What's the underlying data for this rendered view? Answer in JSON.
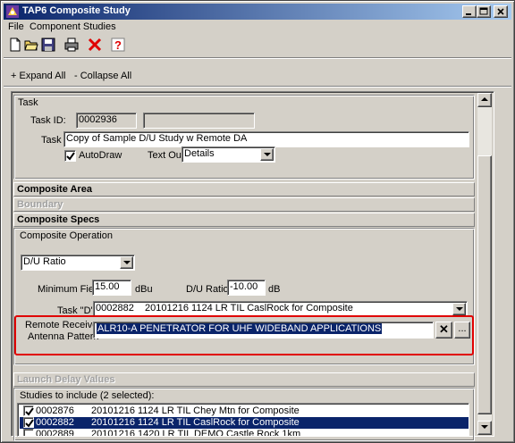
{
  "window": {
    "title": "TAP6 Composite Study"
  },
  "menu": {
    "file": "File",
    "component_studies": "Component Studies"
  },
  "toolbar": {
    "icons": [
      "new-icon",
      "open-icon",
      "save-icon",
      "print-icon",
      "delete-icon",
      "help-icon"
    ]
  },
  "links": {
    "expand_all": "+ Expand All",
    "collapse_all": "- Collapse All"
  },
  "task": {
    "group_label": "Task",
    "id_label": "Task ID:",
    "id_value": "0002936",
    "id_extra_value": "",
    "name_label": "Task",
    "name_value": "Copy of Sample D/U Study w Remote DA",
    "autodraw_label": "AutoDraw",
    "autodraw_checked": true,
    "textout_label": "Text Out:",
    "textout_value": "Details"
  },
  "sections": {
    "composite_area": "Composite Area",
    "boundary": "Boundary",
    "composite_specs": "Composite Specs",
    "launch_delay": "Launch Delay Values"
  },
  "composite_operation": {
    "group_label": "Composite Operation",
    "operation_value": "D/U Ratio",
    "min_field_label": "Minimum Field",
    "min_field_value": "15.00",
    "min_field_unit": "dBu",
    "du_ratio_label": "D/U Ratio",
    "du_ratio_value": "-10.00",
    "du_ratio_unit": "dB",
    "task_d_label": "Task \"D\"",
    "task_d_value": "0002882    20101216 1124 LR TIL CaslRock for Composite",
    "remote_receiver_label_1": "Remote Receiver",
    "remote_receiver_label_2": "Antenna Pattern",
    "antenna_pattern_value": "ALR10-A PENETRATOR FOR UHF WIDEBAND APPLICATIONS",
    "clear_button": "✕",
    "browse_button": "..."
  },
  "studies": {
    "label": "Studies to include (2 selected):",
    "rows": [
      {
        "id": "0002876",
        "desc": "20101216 1124 LR TIL Chey Mtn for Composite",
        "checked": true,
        "selected": false
      },
      {
        "id": "0002882",
        "desc": "20101216 1124 LR TIL CaslRock for Composite",
        "checked": true,
        "selected": true
      },
      {
        "id": "0002889",
        "desc": "20101216 1420 LR TIL DEMO Castle Rock 1km",
        "checked": false,
        "selected": false
      }
    ]
  }
}
